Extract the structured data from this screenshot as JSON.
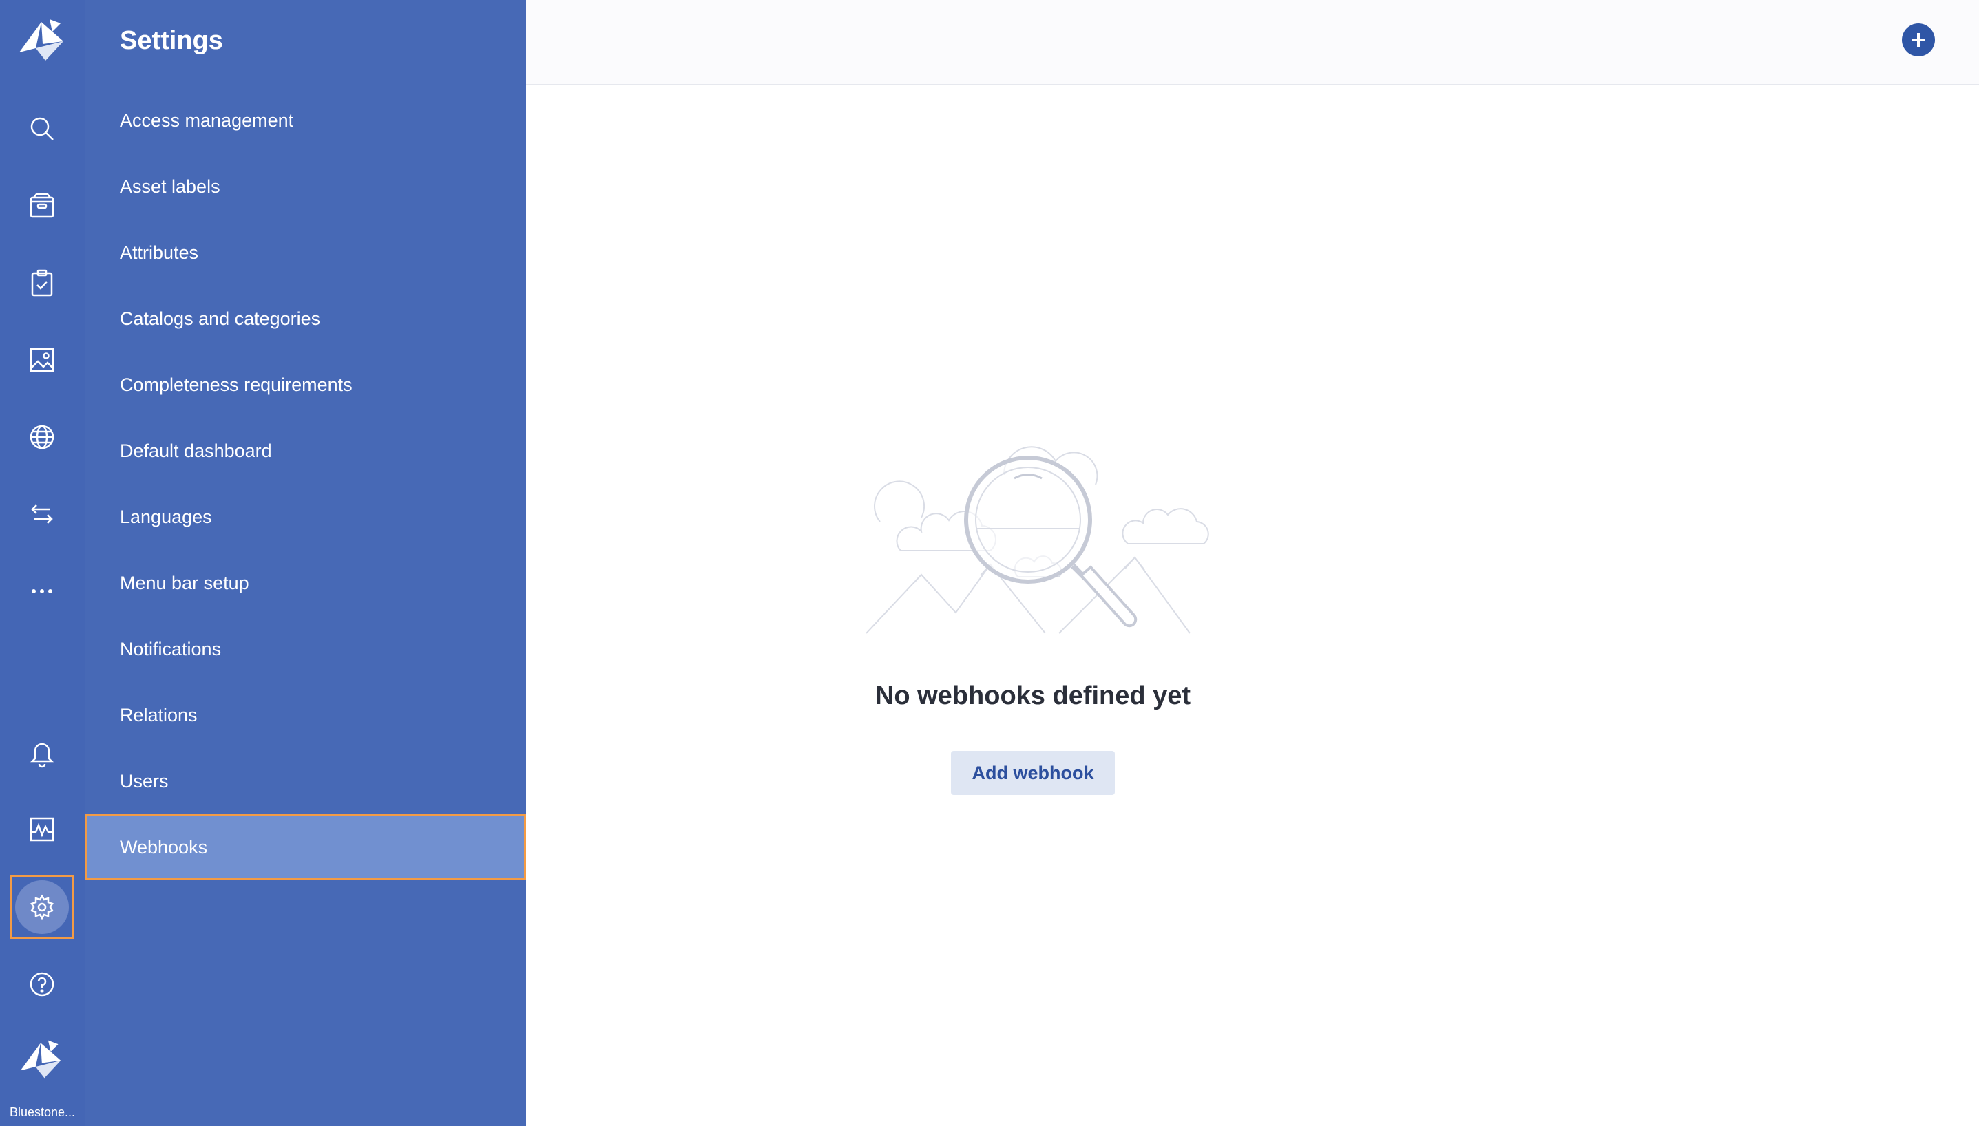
{
  "rail": {
    "icons": [
      "logo-icon",
      "search-icon",
      "box-icon",
      "clipboard-check-icon",
      "image-icon",
      "globe-icon",
      "arrows-exchange-icon",
      "more-dots-icon",
      "bell-icon",
      "activity-icon",
      "gear-icon",
      "help-icon"
    ],
    "org_name": "Bluestone..."
  },
  "settings": {
    "title": "Settings",
    "items": [
      {
        "label": "Access management"
      },
      {
        "label": "Asset labels"
      },
      {
        "label": "Attributes"
      },
      {
        "label": "Catalogs and categories"
      },
      {
        "label": "Completeness requirements"
      },
      {
        "label": "Default dashboard"
      },
      {
        "label": "Languages"
      },
      {
        "label": "Menu bar setup"
      },
      {
        "label": "Notifications"
      },
      {
        "label": "Relations"
      },
      {
        "label": "Users"
      },
      {
        "label": "Webhooks"
      }
    ],
    "active": "Webhooks"
  },
  "main": {
    "empty_title": "No webhooks defined yet",
    "add_button": "Add webhook"
  },
  "colors": {
    "rail": "#4466b5",
    "sidebar": "#4769b6",
    "active_item": "#7190d0",
    "highlight": "#f39b45",
    "fab": "#2f56a6"
  }
}
